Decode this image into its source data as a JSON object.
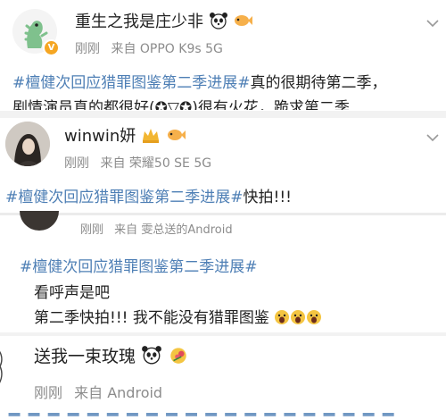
{
  "posts": [
    {
      "username": "重生之我是庄少非",
      "time": "刚刚",
      "source_prefix": "来自",
      "source": "OPPO K9s 5G",
      "text_parts": [
        "#檀健次回应猎罪图鉴第二季进展#",
        "真的很期待第二季，"
      ],
      "text_line2": "剧情演员真的都很好(✪▽✪)很有火花，跪求第二季",
      "icons": [
        "dinosaur-avatar",
        "panda-emoji",
        "fish-badge-icon",
        "vip-badge-icon",
        "chevron-down-icon"
      ]
    },
    {
      "username": "winwin妍",
      "time": "刚刚",
      "source_prefix": "来自",
      "source": "荣耀50 SE 5G",
      "text_parts": [
        "#檀健次回应猎罪图鉴第二季进展#",
        "快拍!!!"
      ],
      "icons": [
        "girl-avatar",
        "crown-badge-icon",
        "fish-badge-icon",
        "chevron-down-icon"
      ]
    },
    {
      "time": "刚刚",
      "source_prefix": "来自",
      "source": "雯总送的Android",
      "tag": "#檀健次回应猎罪图鉴第二季进展#",
      "line2": "看呼声是吧",
      "line3": "第二季快拍!!! 我不能没有猎罪图鉴",
      "icons": [
        "scream-emoji",
        "scream-emoji",
        "scream-emoji"
      ]
    },
    {
      "text": "送我一束玫瑰",
      "time": "刚刚",
      "source_prefix": "来自",
      "source": "Android",
      "icons": [
        "panda-emoji",
        "rose-bouquet-emoji"
      ]
    }
  ],
  "colors": {
    "topic_blue": "#4e7fb5",
    "meta_gray": "#8c8c8c",
    "separator": "#f2f2f2"
  }
}
